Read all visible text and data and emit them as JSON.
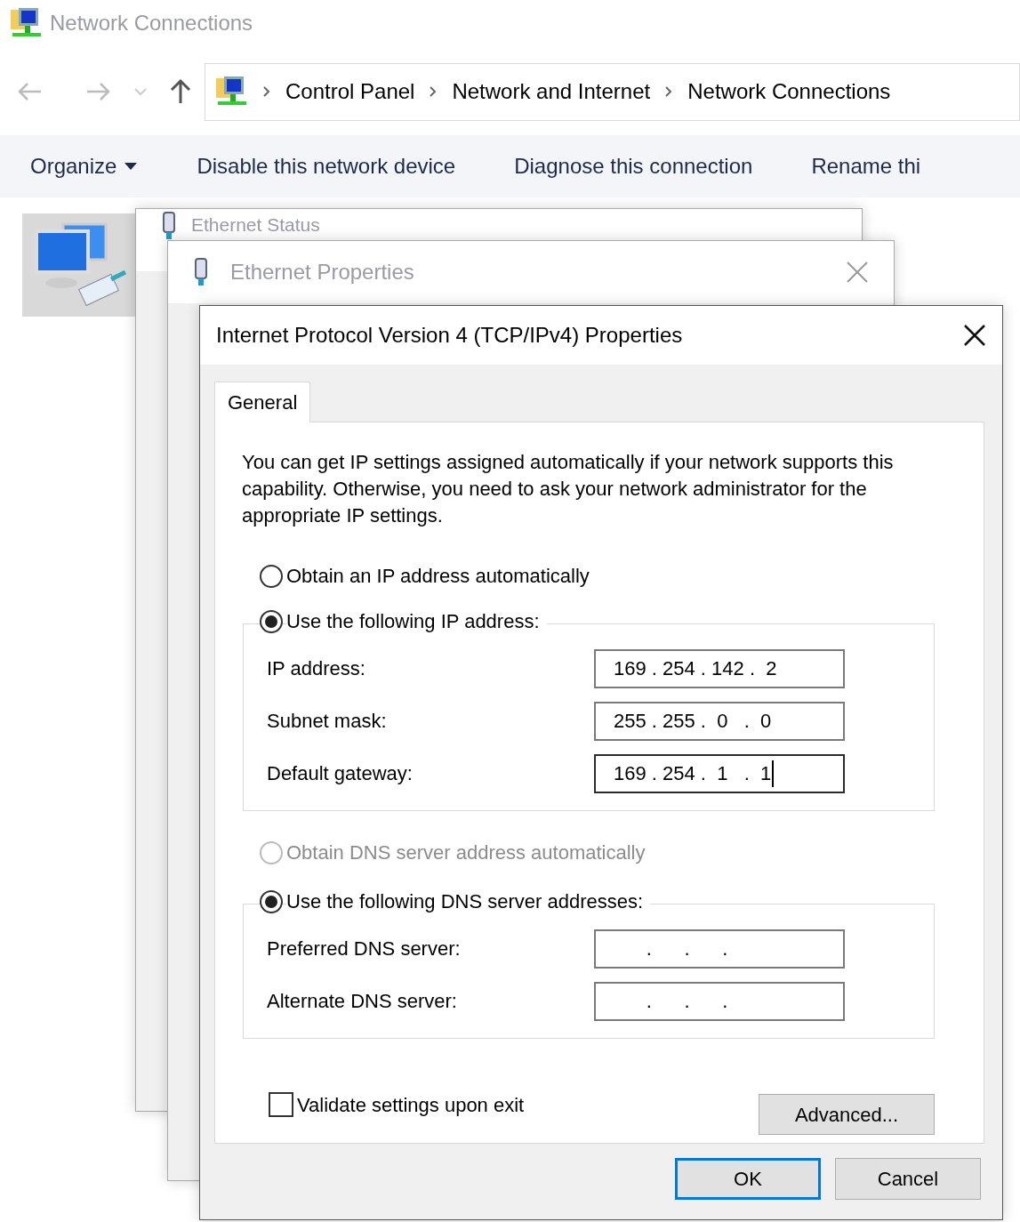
{
  "window": {
    "title": "Network Connections"
  },
  "address_bar": {
    "crumbs": [
      "Control Panel",
      "Network and Internet",
      "Network Connections"
    ]
  },
  "command_bar": {
    "items": [
      {
        "label": "Organize",
        "kind": "menu"
      },
      {
        "label": "Disable this network device",
        "kind": "command"
      },
      {
        "label": "Diagnose this connection",
        "kind": "command"
      },
      {
        "label": "Rename thi",
        "kind": "command"
      }
    ]
  },
  "status_window": {
    "title": "Ethernet Status"
  },
  "properties_window": {
    "title": "Ethernet Properties"
  },
  "ipv4_dialog": {
    "title": "Internet Protocol Version 4 (TCP/IPv4) Properties",
    "tabs": [
      {
        "label": "General",
        "selected": true
      }
    ],
    "intro": "You can get IP settings assigned automatically if your network supports this capability. Otherwise, you need to ask your network administrator for the appropriate IP settings.",
    "ip_options": [
      {
        "label": "Obtain an IP address automatically",
        "selected": false,
        "disabled": false
      },
      {
        "label": "Use the following IP address:",
        "selected": true,
        "disabled": false
      }
    ],
    "ip_fields": [
      {
        "label": "IP address:",
        "value": "169 . 254 . 142 .  2",
        "focused": false
      },
      {
        "label": "Subnet mask:",
        "value": "255 . 255 .  0   .  0",
        "focused": false
      },
      {
        "label": "Default gateway:",
        "value": "169 . 254 .  1   .  1",
        "focused": true
      }
    ],
    "dns_options": [
      {
        "label": "Obtain DNS server address automatically",
        "selected": false,
        "disabled": true
      },
      {
        "label": "Use the following DNS server addresses:",
        "selected": true,
        "disabled": false
      }
    ],
    "dns_fields": [
      {
        "label": "Preferred DNS server:",
        "value": "      .      .      .",
        "focused": false
      },
      {
        "label": "Alternate DNS server:",
        "value": "      .      .      .",
        "focused": false
      }
    ],
    "validate": {
      "label": "Validate settings upon exit",
      "checked": false
    },
    "advanced_button": "Advanced...",
    "buttons": [
      {
        "label": "OK",
        "default": true
      },
      {
        "label": "Cancel",
        "default": false
      }
    ]
  }
}
